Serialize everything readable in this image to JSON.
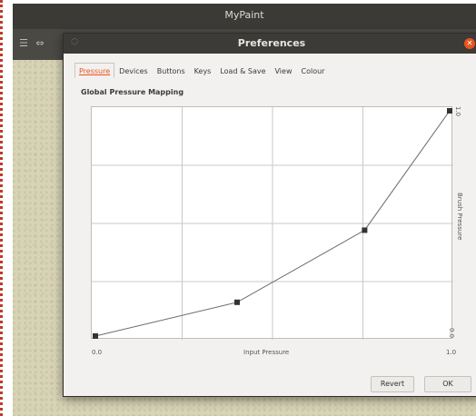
{
  "app": {
    "title": "MyPaint"
  },
  "dialog": {
    "title": "Preferences",
    "tabs": [
      "Pressure",
      "Devices",
      "Buttons",
      "Keys",
      "Load & Save",
      "View",
      "Colour"
    ],
    "active_tab": "Pressure",
    "section_title": "Global Pressure Mapping",
    "buttons": {
      "revert": "Revert",
      "ok": "OK"
    }
  },
  "graph": {
    "x_min_label": "0.0",
    "x_max_label": "1.0",
    "x_axis_label": "Input Pressure",
    "y_min_label": "0.0",
    "y_max_label": "1.0",
    "y_axis_label": "Brush Pressure",
    "points": [
      {
        "x": 0.0,
        "y": 0.0
      },
      {
        "x": 0.4,
        "y": 0.15
      },
      {
        "x": 0.76,
        "y": 0.47
      },
      {
        "x": 1.0,
        "y": 1.0
      }
    ]
  },
  "colors": {
    "accent": "#e95420",
    "titlebar": "#3c3b37",
    "canvas": "#d7d3b5"
  },
  "icons": {
    "close": "close-icon",
    "menu": "window-menu-icon"
  }
}
